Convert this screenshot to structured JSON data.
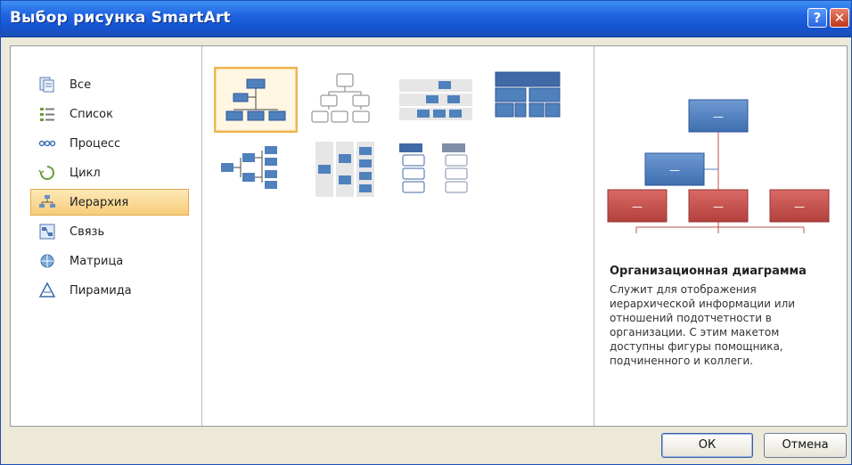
{
  "window": {
    "title": "Выбор рисунка SmartArt",
    "help_label": "?",
    "close_label": "✕"
  },
  "categories": [
    {
      "label": "Все",
      "icon": "all-icon"
    },
    {
      "label": "Список",
      "icon": "list-icon"
    },
    {
      "label": "Процесс",
      "icon": "process-icon"
    },
    {
      "label": "Цикл",
      "icon": "cycle-icon"
    },
    {
      "label": "Иерархия",
      "icon": "hierarchy-icon",
      "selected": true
    },
    {
      "label": "Связь",
      "icon": "relationship-icon"
    },
    {
      "label": "Матрица",
      "icon": "matrix-icon"
    },
    {
      "label": "Пирамида",
      "icon": "pyramid-icon"
    }
  ],
  "layouts": [
    {
      "icon": "organization-chart-icon",
      "selected": true
    },
    {
      "icon": "hierarchy-outline-icon"
    },
    {
      "icon": "labeled-hierarchy-icon"
    },
    {
      "icon": "table-hierarchy-icon"
    },
    {
      "icon": "horizontal-hierarchy-icon"
    },
    {
      "icon": "horizontal-labeled-hierarchy-icon"
    },
    {
      "icon": "hierarchy-list-icon"
    }
  ],
  "preview": {
    "title": "Организационная диаграмма",
    "description_lines": [
      "Служит для отображения",
      "иерархической информации или",
      "отношений подотчетности в",
      "организации. С этим макетом",
      "доступны фигуры помощника,",
      "подчиненного и коллеги."
    ],
    "shape_placeholder": "—"
  },
  "buttons": {
    "ok": "ОК",
    "cancel": "Отмена"
  },
  "colors": {
    "accent_blue": "#4f81bd",
    "preview_red": "#c0504d",
    "selection_orange": "#f7cd7a"
  }
}
